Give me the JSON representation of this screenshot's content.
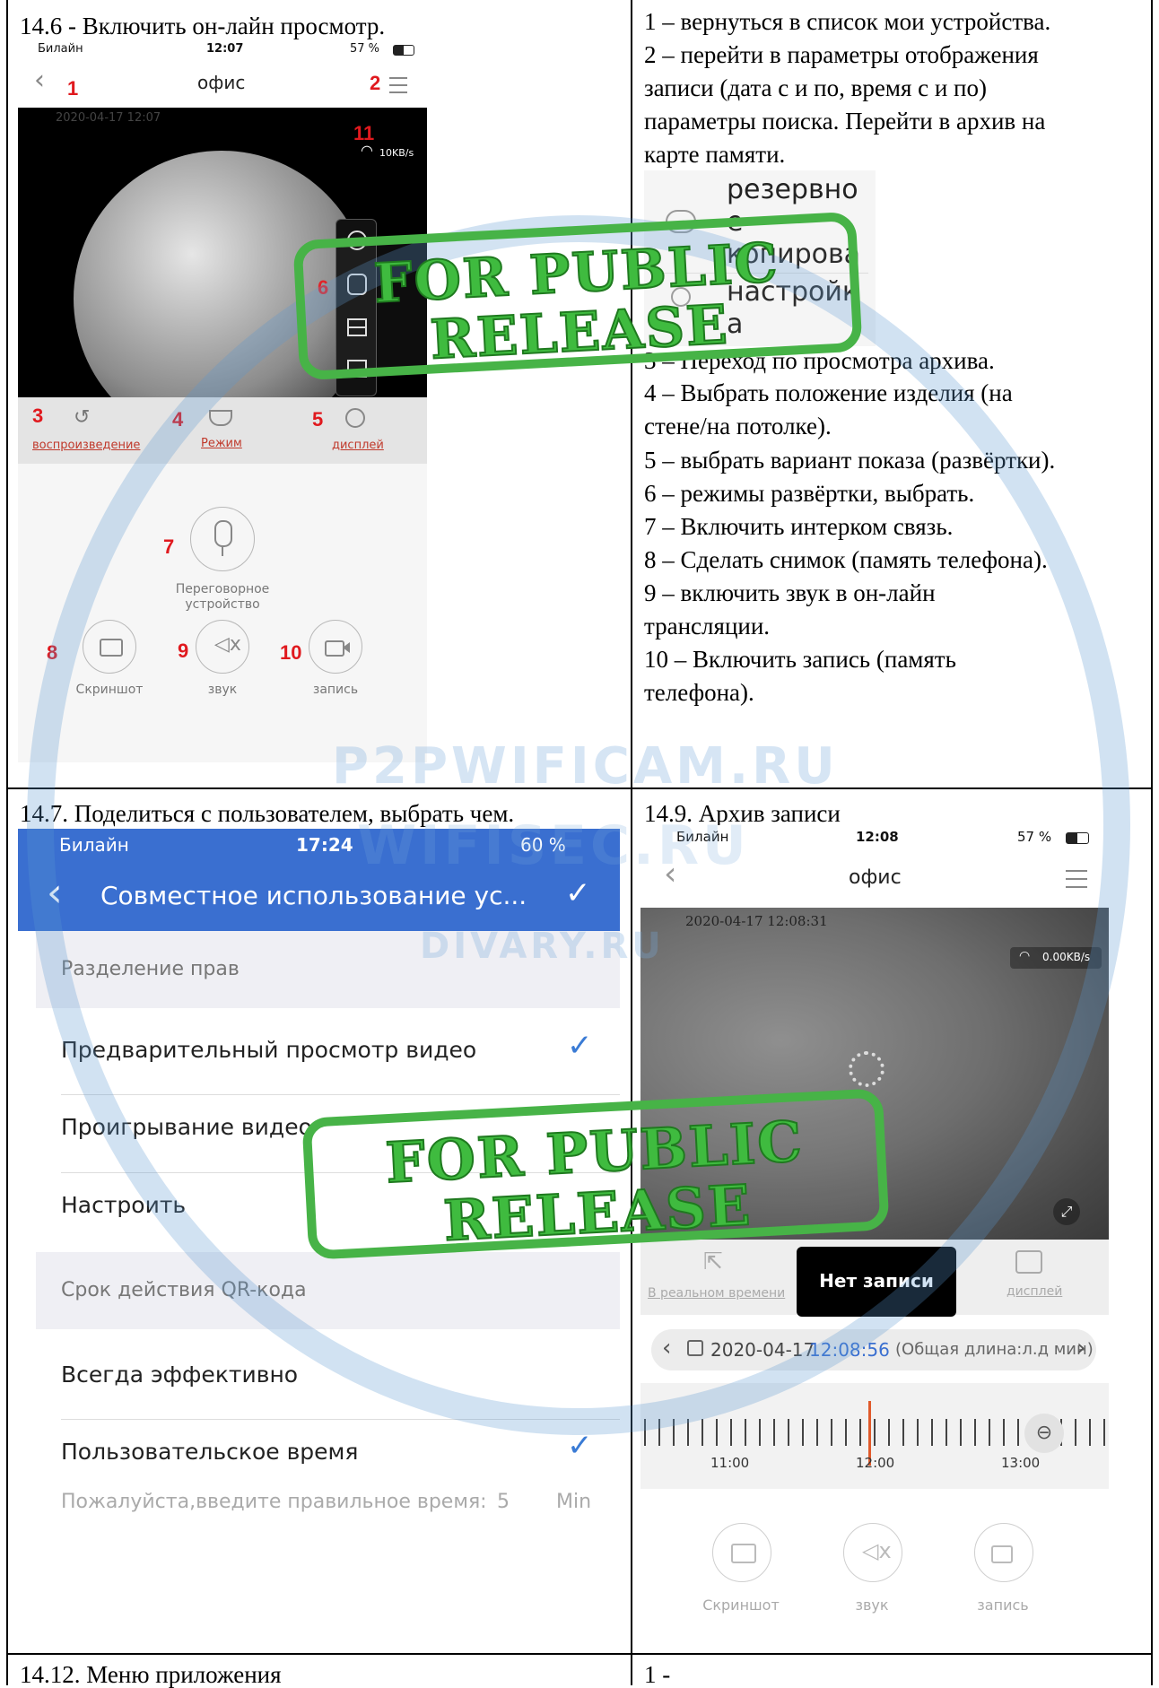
{
  "section1": {
    "title": "14.6 - Включить он-лайн просмотр.",
    "phone": {
      "carrier": "Билайн",
      "time": "12:07",
      "battery": "57 %",
      "device_name": "офис",
      "wifi_speed": "10KB/s",
      "markers": [
        "1",
        "2",
        "3",
        "4",
        "5",
        "6",
        "7",
        "8",
        "9",
        "10",
        "11"
      ],
      "tab_playback": "воспроизведение",
      "tab_mode": "Режим",
      "tab_display": "дисплей",
      "intercom_label": "Переговорное устройство",
      "screenshot_label": "Скриншот",
      "sound_label": "звук",
      "record_label": "запись"
    },
    "popup_items": [
      "резервно",
      "е",
      "копирова",
      "настройк",
      "а"
    ],
    "descriptions": [
      "1 – вернуться в список мои устройства.",
      "2 – перейти в параметры отображения",
      "записи (дата с и по, время с и по)",
      "параметры поиска. Перейти в архив на",
      "карте памяти.",
      "3 – Переход по просмотра архива.",
      "4 – Выбрать положение изделия (на",
      "стене/на потолке).",
      "5 – выбрать вариант показа (развёртки).",
      "6 – режимы развёртки, выбрать.",
      "7 – Включить интерком связь.",
      "8 – Сделать снимок (память телефона).",
      "9 – включить звук в он-лайн",
      "трансляции.",
      "10 – Включить запись (память",
      "телефона)."
    ]
  },
  "section2": {
    "title": "14.7. Поделиться с пользователем, выбрать чем.",
    "phone": {
      "carrier": "Билайн",
      "time": "17:24",
      "battery": "60 %",
      "header_title": "Совместное использование ус...",
      "section_rights": "Разделение прав",
      "rows": [
        "Предварительный просмотр видео",
        "Проигрывание видео",
        "Настроить"
      ],
      "section_qr": "Срок действия QR-кода",
      "rows2": [
        "Всегда эффективно",
        "Пользовательское время"
      ],
      "hint": "Пожалуйста,введите правильное время:",
      "hint_value": "5",
      "hint_unit": "Min"
    }
  },
  "section3": {
    "title": "14.9. Архив записи",
    "phone": {
      "carrier": "Билайн",
      "time": "12:08",
      "battery": "57 %",
      "device_name": "офис",
      "overlay_datetime": "2020-04-17 12:08:31",
      "wifi_speed": "0.00KB/s",
      "tab_live": "В реальном времени",
      "no_record": "Нет записи",
      "tab_display": "дисплей",
      "date": "2020-04-17",
      "time_value": "12:08:56",
      "length": "(Общая длина:л.д мин)",
      "timeline_ticks": [
        "11:00",
        "12:00",
        "13:00"
      ],
      "screenshot_label": "Скриншот",
      "sound_label": "звук",
      "record_label": "запись"
    }
  },
  "section4": {
    "title": "14.12. Меню приложения",
    "right": "1 -"
  },
  "watermarks": {
    "stamp_line1": "FOR PUBLIC",
    "stamp_line2": "RELEASE",
    "sites": [
      "P2PWIFICAM.RU",
      "WIFISEC.RU",
      "DIVARY.RU"
    ]
  },
  "colors": {
    "accent_blue": "#3a6fd0",
    "marker_red": "#e0191e",
    "stamp_green": "#47b347"
  }
}
